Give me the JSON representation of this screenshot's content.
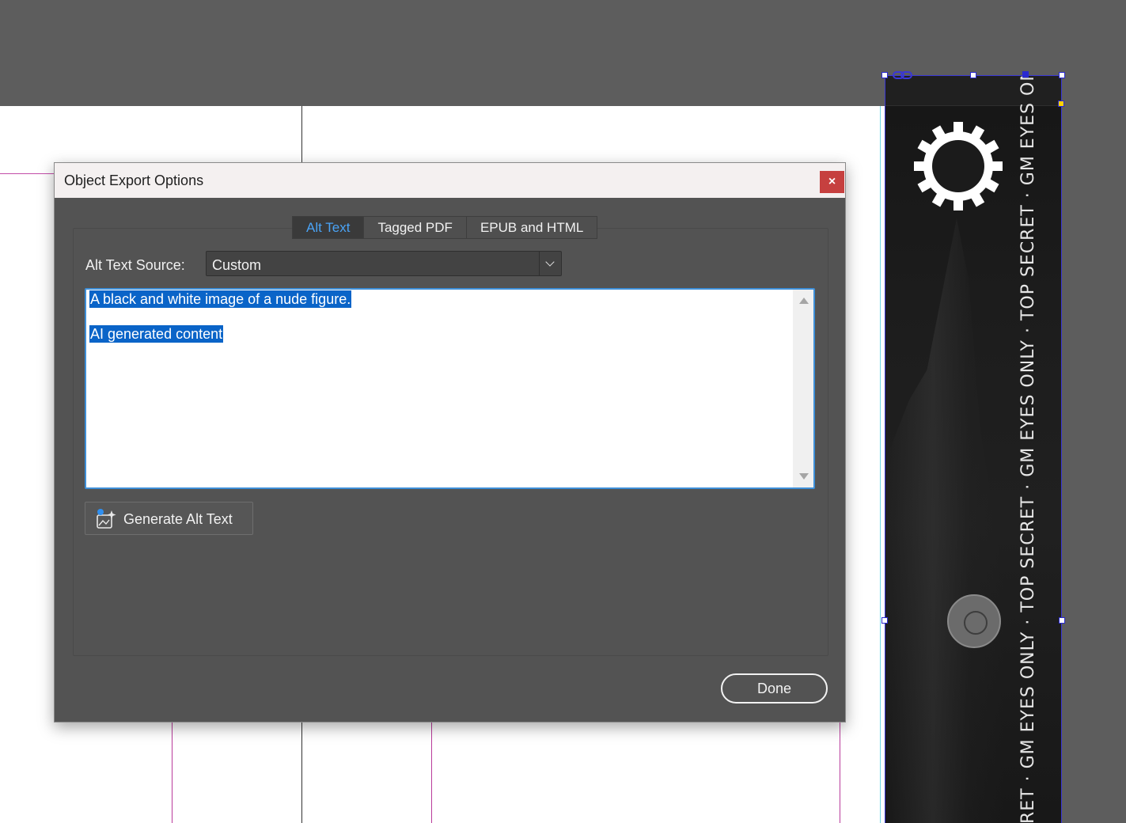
{
  "dialog": {
    "title": "Object Export Options",
    "close_glyph": "×",
    "tabs": [
      {
        "label": "Alt Text",
        "active": true
      },
      {
        "label": "Tagged PDF",
        "active": false
      },
      {
        "label": "EPUB and HTML",
        "active": false
      }
    ],
    "alt_text_source_label": "Alt Text Source:",
    "alt_text_source_value": "Custom",
    "alt_text_lines": [
      "A black and white image of a nude figure.",
      "AI generated content"
    ],
    "generate_button_label": "Generate Alt Text",
    "done_button_label": "Done"
  },
  "artwork": {
    "vertical_text": "RET · GM EYES ONLY · TOP SECRET · GM EYES ONLY · TOP SECRET · GM EYES ON"
  },
  "colors": {
    "accent_blue": "#4aa3f5",
    "selection_blue": "#0a64c8",
    "close_red": "#c6403f",
    "frame_selection": "#2a2ad0"
  },
  "icons": {
    "close": "close-icon",
    "dropdown": "chevron-down-icon",
    "generate": "ai-sparkle-icon",
    "link": "link-icon"
  }
}
